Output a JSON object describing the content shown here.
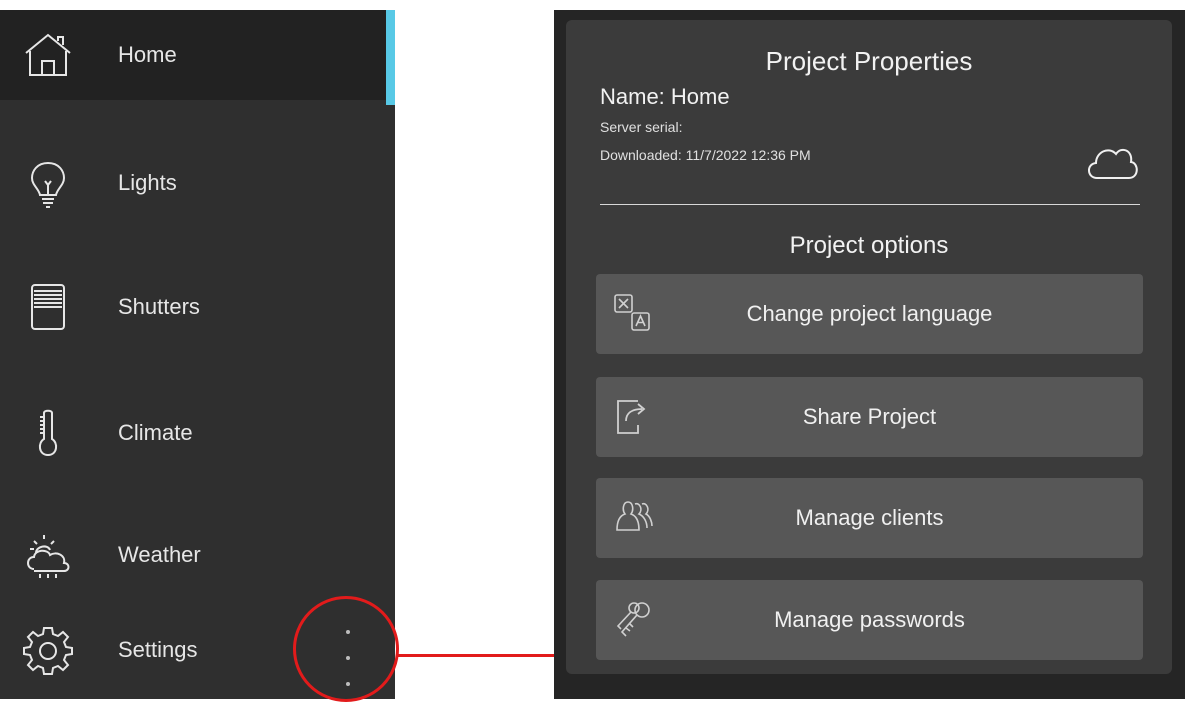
{
  "sidebar": {
    "items": [
      {
        "label": "Home",
        "icon": "home-icon",
        "active": true
      },
      {
        "label": "Lights",
        "icon": "lightbulb-icon"
      },
      {
        "label": "Shutters",
        "icon": "shutters-icon"
      },
      {
        "label": "Climate",
        "icon": "thermometer-icon"
      },
      {
        "label": "Weather",
        "icon": "weather-icon"
      },
      {
        "label": "Settings",
        "icon": "gear-icon"
      }
    ],
    "more_icon": "more-vertical-icon",
    "accent_color": "#58c9e6"
  },
  "panel": {
    "title": "Project Properties",
    "name_line": "Name: Home",
    "serial_line": "Server serial:",
    "downloaded_line": "Downloaded: 11/7/2022 12:36 PM",
    "cloud_icon": "cloud-icon",
    "options_title": "Project options",
    "options": [
      {
        "label": "Change project language",
        "icon": "translate-icon"
      },
      {
        "label": "Share Project",
        "icon": "share-icon"
      },
      {
        "label": "Manage clients",
        "icon": "users-icon"
      },
      {
        "label": "Manage passwords",
        "icon": "keys-icon"
      }
    ]
  },
  "callout_color": "#e21b1b"
}
